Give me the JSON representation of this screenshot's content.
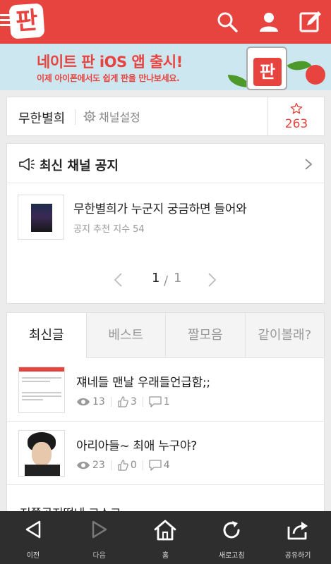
{
  "banner": {
    "title": "네이트 판 iOS 앱 출시!",
    "subtitle": "이제 아이폰에서도 쉽게 판을 만나보세요.",
    "logo_text": "판"
  },
  "topbar": {
    "logo_text": "판",
    "icons": [
      "menu-icon",
      "search-icon",
      "user-icon",
      "write-icon"
    ]
  },
  "channel": {
    "name": "무한별희",
    "settings_label": "채널설정",
    "star_count": "263"
  },
  "notice": {
    "title": "최신 채널 공지",
    "item_title": "무한별희가 누군지 궁금하면 들어와",
    "item_meta": "공지 추천 지수 54",
    "page_current": "1",
    "page_separator": "/",
    "page_total": "1"
  },
  "tabs": [
    {
      "label": "최신글",
      "active": true
    },
    {
      "label": "베스트",
      "active": false
    },
    {
      "label": "짤모음",
      "active": false
    },
    {
      "label": "같이볼래?",
      "active": false
    }
  ],
  "posts": [
    {
      "title": "쟤네들 맨날 우래들언급함;;",
      "views": "13",
      "likes": "3",
      "comments": "1"
    },
    {
      "title": "아리아들~ 최애 누구야?",
      "views": "23",
      "likes": "0",
      "comments": "4"
    }
  ],
  "partial_post_title": "저쪽공지떴네 크스크",
  "bottom_nav": [
    {
      "label": "이전"
    },
    {
      "label": "다음"
    },
    {
      "label": "홈"
    },
    {
      "label": "새로고침"
    },
    {
      "label": "공유하기"
    }
  ],
  "colors": {
    "accent": "#e8443f",
    "banner_bg": "#cde7f0",
    "nav_bg": "#2e2e2e"
  }
}
